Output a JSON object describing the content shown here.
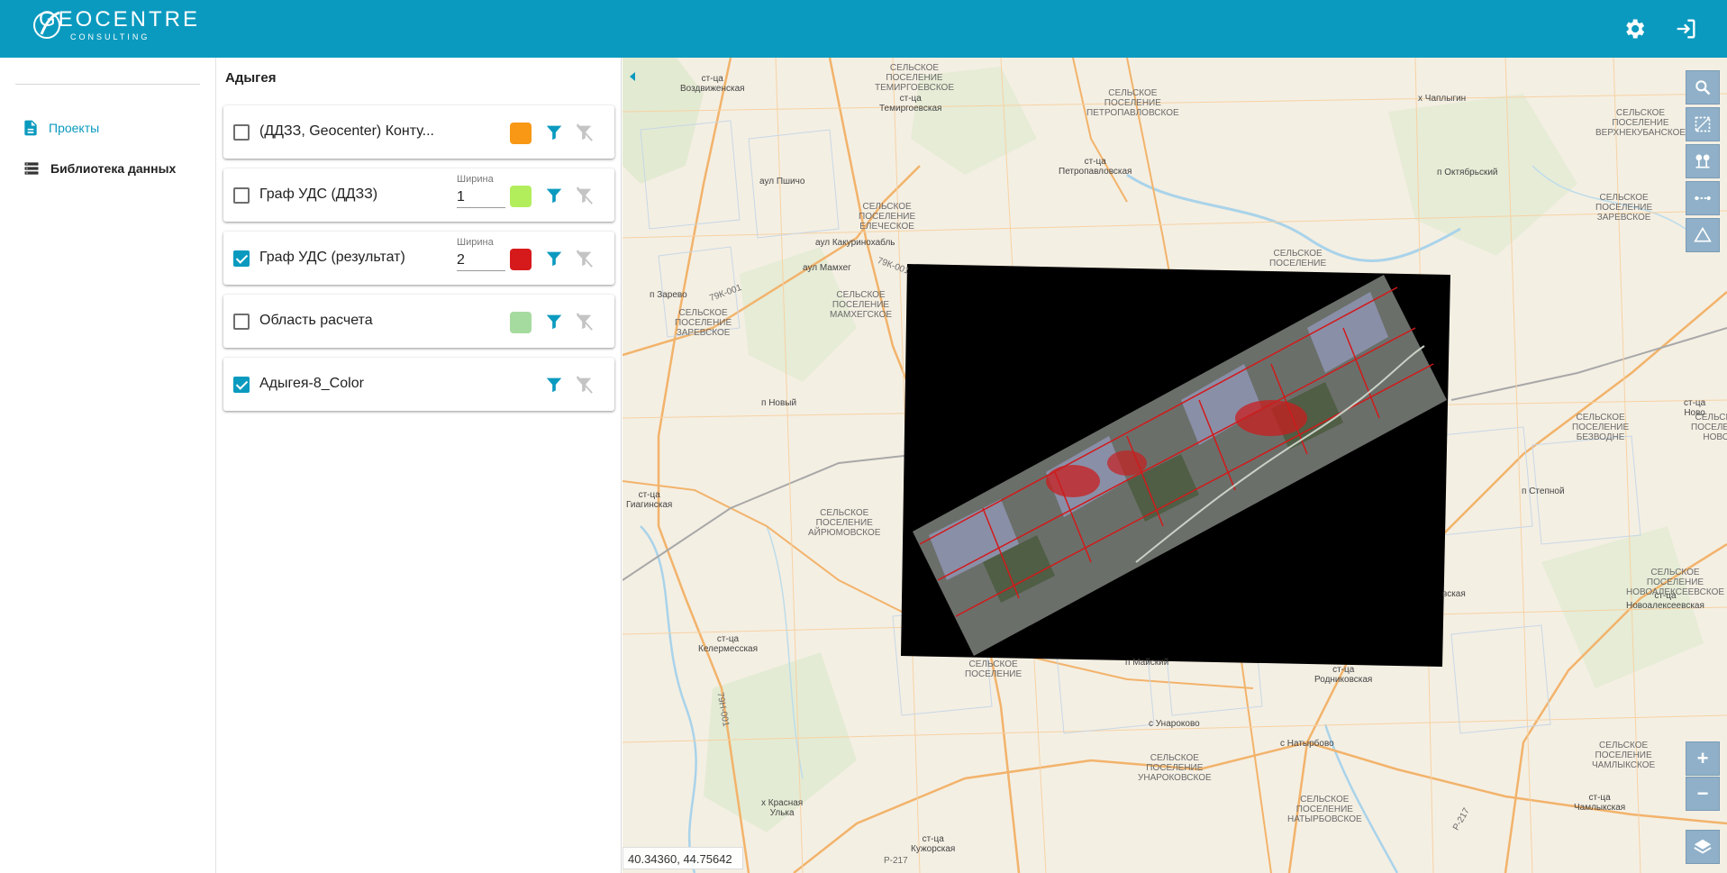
{
  "app": {
    "logo_main": "GEOCENTRE",
    "logo_sub": "CONSULTING",
    "settings_icon": "gear-icon",
    "logout_icon": "logout-icon"
  },
  "sidebar": {
    "items": [
      {
        "label": "Проекты",
        "icon": "document-icon",
        "active": true
      },
      {
        "label": "Библиотека данных",
        "icon": "database-icon",
        "active": false
      }
    ]
  },
  "layers_panel": {
    "title": "Адыгея",
    "layers": [
      {
        "name": "(ДДЗЗ, Geocenter) Конту...",
        "checked": false,
        "width_label": "",
        "width": "",
        "color": "#f89814",
        "has_color": true
      },
      {
        "name": "Граф УДС (ДДЗЗ)",
        "checked": false,
        "width_label": "Ширина",
        "width": "1",
        "color": "#b2ee5c",
        "has_color": true
      },
      {
        "name": "Граф УДС (результат)",
        "checked": true,
        "width_label": "Ширина",
        "width": "2",
        "color": "#d61a1c",
        "has_color": true
      },
      {
        "name": "Область расчета",
        "checked": false,
        "width_label": "",
        "width": "",
        "color": "#a6dba0",
        "has_color": true
      },
      {
        "name": "Адыгея-8_Color",
        "checked": true,
        "width_label": "",
        "width": "",
        "color": "",
        "has_color": false
      }
    ]
  },
  "map": {
    "coordinates": "40.34360, 44.75642",
    "places": [
      {
        "text": "ст-ца\nВоздвиженская",
        "kind": "town"
      },
      {
        "text": "СЕЛЬСКОЕ\nПОСЕЛЕНИЕ\nТЕМИРГОЕВСКОЕ",
        "kind": "area"
      },
      {
        "text": "ст-ца\nТемиргоевская",
        "kind": "town"
      },
      {
        "text": "СЕЛЬСКОЕ\nПОСЕЛЕНИЕ\nПЕТРОПАВЛОВСКОЕ",
        "kind": "area"
      },
      {
        "text": "х Чаплыгин",
        "kind": "town"
      },
      {
        "text": "СЕЛЬСКОЕ\nПОСЕЛЕНИЕ\nВЕРХНЕКУБАНСКОЕ",
        "kind": "area"
      },
      {
        "text": "ст-ца\nПетропавловская",
        "kind": "town"
      },
      {
        "text": "п Октябрьский",
        "kind": "town"
      },
      {
        "text": "аул Пшичо",
        "kind": "town"
      },
      {
        "text": "СЕЛЬСКОЕ\nПОСЕЛЕНИЕ\nЕЛЕЧЕСКОЕ",
        "kind": "area"
      },
      {
        "text": "аул Какуринохабль",
        "kind": "town"
      },
      {
        "text": "аул Мамхег",
        "kind": "town"
      },
      {
        "text": "СЕЛЬСКОЕ\nПОСЕЛЕНИЕ\nМАМХЕГСКОЕ",
        "kind": "area"
      },
      {
        "text": "п Зарево",
        "kind": "town"
      },
      {
        "text": "СЕЛЬСКОЕ\nПОСЕЛЕНИЕ\nЗАРЕВСКОЕ",
        "kind": "area"
      },
      {
        "text": "СЕЛЬСКОЕ\nПОСЕЛЕНИЕ",
        "kind": "area"
      },
      {
        "text": "п Новый",
        "kind": "town"
      },
      {
        "text": "ст-ца\nГиагинская",
        "kind": "town"
      },
      {
        "text": "СЕЛЬСКОЕ\nПОСЕЛЕНИЕ\nАЙРЮМОВСКОЕ",
        "kind": "area"
      },
      {
        "text": "п Степной",
        "kind": "town"
      },
      {
        "text": "СЕЛЬСКОЕ\nПОСЕЛЕНИЕ\nБЕЗВОДНЕ",
        "kind": "area"
      },
      {
        "text": "СЕЛЬСКОЕ\nПОСЕЛЕНИЕ\nНОВОАЛЕКСЕЕВСКОЕ",
        "kind": "area"
      },
      {
        "text": "ст-ца\nНовоалексеевская",
        "kind": "town"
      },
      {
        "text": "ст-ца\nКелермесская",
        "kind": "town"
      },
      {
        "text": "п Майский",
        "kind": "town"
      },
      {
        "text": "ст-ца\nРодниковская",
        "kind": "town"
      },
      {
        "text": "с Унароково",
        "kind": "town"
      },
      {
        "text": "с Натырбово",
        "kind": "town"
      },
      {
        "text": "СЕЛЬСКОЕ\nПОСЕЛЕНИЕ\nУНАРОКОВСКОЕ",
        "kind": "area"
      },
      {
        "text": "СЕЛЬСКОЕ\nПОСЕЛЕНИЕ\nНАТЫРБОВСКОЕ",
        "kind": "area"
      },
      {
        "text": "СЕЛЬСКОЕ\nПОСЕЛЕНИЕ\nЧАМЛЫКСКОЕ",
        "kind": "area"
      },
      {
        "text": "ст-ца\nЧамлыкская",
        "kind": "town"
      },
      {
        "text": "х Красная\nУлька",
        "kind": "town"
      },
      {
        "text": "ст-ца\nКужорская",
        "kind": "town"
      },
      {
        "text": "вская",
        "kind": "town"
      },
      {
        "text": "ст-ца\nНово",
        "kind": "town"
      },
      {
        "text": "СЕЛЬСКОЕ\nПОСЕЛЕНИЕ\nЗАРЕВСКОЕ",
        "kind": "area"
      },
      {
        "text": "СЕЛЬСКОЕ\nПОСЕЛЕНИЕ",
        "kind": "area"
      },
      {
        "text": "СЕЛЬСКОЕ\nПОСЕЛЕНИЕ\nНОВОС",
        "kind": "area"
      }
    ],
    "roads": [
      "79К-001",
      "79К-001",
      "79Н-001",
      "Р-217",
      "Р-217"
    ],
    "tools": [
      "zoom-area-icon",
      "select-area-icon",
      "route-icon",
      "measure-distance-icon",
      "measure-area-icon"
    ],
    "zoom_in": "+",
    "zoom_out": "−",
    "layers_icon": "layers-icon"
  }
}
